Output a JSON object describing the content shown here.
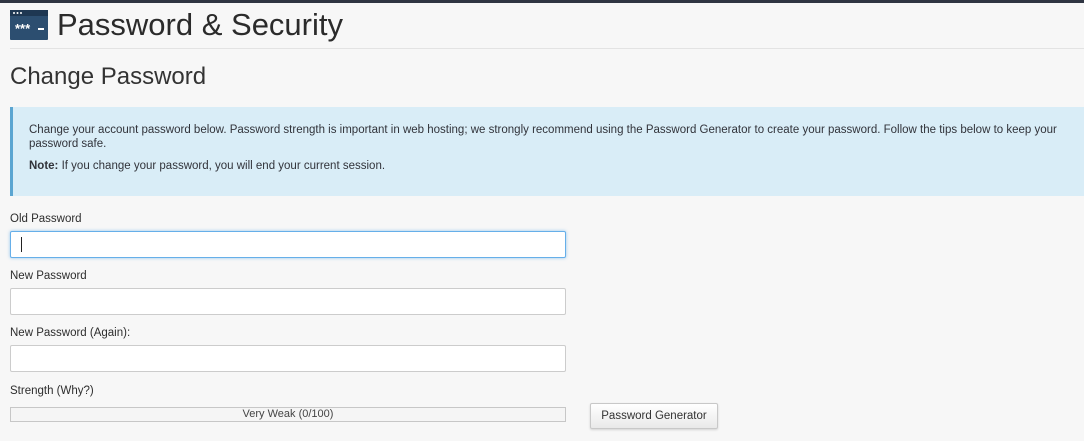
{
  "header": {
    "title": "Password & Security",
    "icon": "password-icon",
    "icon_text": "***"
  },
  "section": {
    "title": "Change Password"
  },
  "info": {
    "message": "Change your account password below. Password strength is important in web hosting; we strongly recommend using the Password Generator to create your password. Follow the tips below to keep your password safe.",
    "note_label": "Note:",
    "note_text": " If you change your password, you will end your current session."
  },
  "form": {
    "old_password": {
      "label": "Old Password",
      "value": ""
    },
    "new_password": {
      "label": "New Password",
      "value": ""
    },
    "new_password_again": {
      "label": "New Password (Again):",
      "value": ""
    },
    "strength": {
      "label": "Strength (Why?)",
      "text": "Very Weak (0/100)",
      "value": 0,
      "max": 100
    },
    "generator_button": "Password Generator"
  },
  "colors": {
    "info_background": "#d9edf7",
    "info_border": "#5ba5d1",
    "focus_border": "#66afe9",
    "header_icon": "#2c4e70"
  }
}
